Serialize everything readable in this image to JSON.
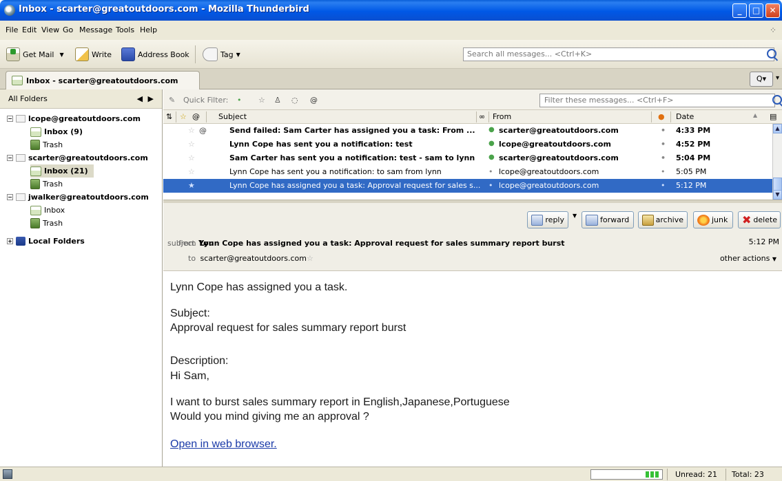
{
  "window": {
    "title": "Inbox - scarter@greatoutdoors.com - Mozilla Thunderbird"
  },
  "menu": [
    {
      "label": "File"
    },
    {
      "label": "Edit"
    },
    {
      "label": "View"
    },
    {
      "label": "Go"
    },
    {
      "label": "Message"
    },
    {
      "label": "Tools"
    },
    {
      "label": "Help"
    }
  ],
  "toolbar": {
    "get_mail": "Get Mail",
    "write": "Write",
    "address_book": "Address Book",
    "tag": "Tag",
    "search_placeholder": "Search all messages... <Ctrl+K>"
  },
  "tab": {
    "label": "Inbox - scarter@greatoutdoors.com"
  },
  "folders": {
    "header": "All Folders",
    "accounts": [
      {
        "name": "lcope@greatoutdoors.com",
        "inbox": "Inbox (9)",
        "trash": "Trash"
      },
      {
        "name": "scarter@greatoutdoors.com",
        "inbox": "Inbox (21)",
        "trash": "Trash"
      },
      {
        "name": "jwalker@greatoutdoors.com",
        "inbox": "Inbox",
        "trash": "Trash"
      }
    ],
    "local": "Local Folders"
  },
  "quick_filter": {
    "label": "Quick Filter:",
    "filter_placeholder": "Filter these messages... <Ctrl+F>"
  },
  "columns": {
    "subject": "Subject",
    "from": "From",
    "date": "Date"
  },
  "messages": [
    {
      "subject": "Send failed: Sam Carter has assigned you a task: From ...",
      "from": "scarter@greatoutdoors.com",
      "date": "4:33 PM",
      "unread": true,
      "attachment": true,
      "selected": false
    },
    {
      "subject": "Lynn Cope has sent you a notification: test",
      "from": "lcope@greatoutdoors.com",
      "date": "4:52 PM",
      "unread": true,
      "attachment": false,
      "selected": false
    },
    {
      "subject": "Sam Carter has sent you a notification: test - sam to lynn",
      "from": "scarter@greatoutdoors.com",
      "date": "5:04 PM",
      "unread": true,
      "attachment": false,
      "selected": false
    },
    {
      "subject": "Lynn Cope has sent you a notification: to sam from lynn",
      "from": "lcope@greatoutdoors.com",
      "date": "5:05 PM",
      "unread": false,
      "attachment": false,
      "selected": false
    },
    {
      "subject": "Lynn Cope has assigned you a task: Approval request for sales s...",
      "from": "lcope@greatoutdoors.com",
      "date": "5:12 PM",
      "unread": false,
      "attachment": false,
      "selected": true
    }
  ],
  "header": {
    "from_label": "from",
    "from_value": "You",
    "subject_label": "subject",
    "subject_value": "Lynn Cope has assigned you a task: Approval request for sales summary report burst",
    "time": "5:12 PM",
    "to_label": "to",
    "to_value": "scarter@greatoutdoors.com",
    "other_actions": "other actions",
    "buttons": {
      "reply": "reply",
      "forward": "forward",
      "archive": "archive",
      "junk": "junk",
      "delete": "delete"
    }
  },
  "body": {
    "line1": "Lynn Cope has assigned you a task.",
    "subject_label": "Subject:",
    "subject_text": "Approval request for sales summary report burst",
    "desc_label": "Description:",
    "greeting": "Hi Sam,",
    "line2": "I want to burst sales summary report in English,Japanese,Portuguese",
    "line3": "Would you mind giving me an approval ?",
    "link": "Open in web browser."
  },
  "status": {
    "unread": "Unread: 21",
    "total": "Total: 23"
  },
  "colors": {
    "titlebar": "#0058e6",
    "selection": "#316ac5",
    "chrome": "#ece9d8"
  }
}
